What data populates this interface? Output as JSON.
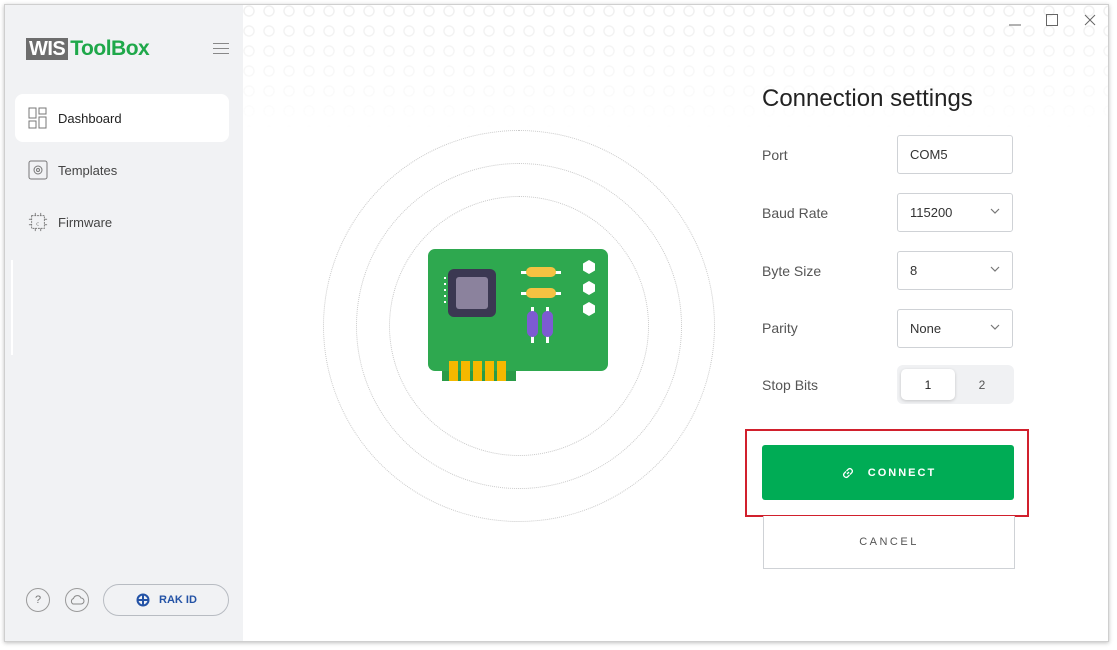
{
  "app": {
    "logo_wis": "WIS",
    "logo_toolbox": "ToolBox"
  },
  "sidebar": {
    "items": [
      {
        "label": "Dashboard",
        "icon": "dashboard-icon",
        "active": true
      },
      {
        "label": "Templates",
        "icon": "templates-icon",
        "active": false
      },
      {
        "label": "Firmware",
        "icon": "chip-icon",
        "active": false
      }
    ],
    "help_label": "?",
    "rak_id_label": "RAK ID"
  },
  "connection": {
    "title": "Connection settings",
    "port": {
      "label": "Port",
      "value": "COM5"
    },
    "baud_rate": {
      "label": "Baud Rate",
      "value": "115200"
    },
    "byte_size": {
      "label": "Byte Size",
      "value": "8"
    },
    "parity": {
      "label": "Parity",
      "value": "None"
    },
    "stop_bits": {
      "label": "Stop Bits",
      "options": [
        "1",
        "2"
      ],
      "selected": "1"
    },
    "connect_label": "CONNECT",
    "cancel_label": "CANCEL"
  },
  "colors": {
    "accent_green": "#00ac55",
    "highlight_red": "#d1202d",
    "sidebar_bg": "#f1f2f4"
  }
}
